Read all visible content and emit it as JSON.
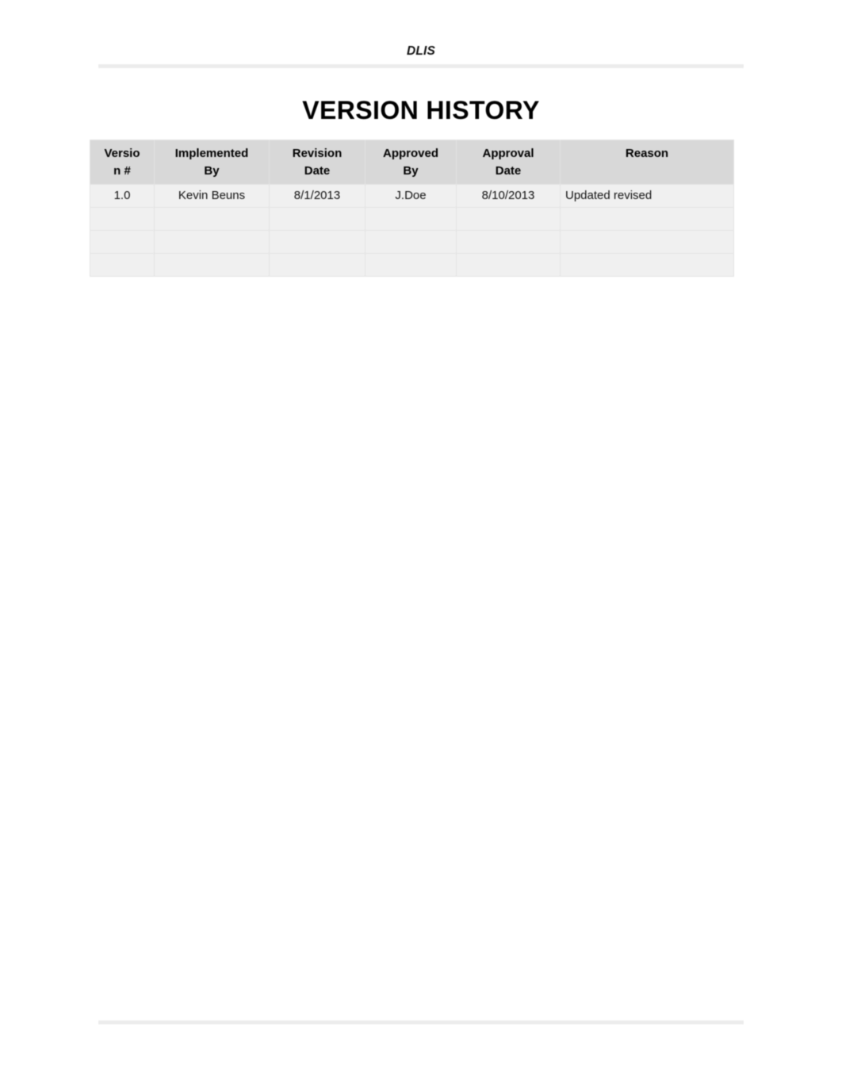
{
  "document": {
    "running_header": "DLIS",
    "page_title": "VERSION HISTORY",
    "footer_text": ""
  },
  "colors": {
    "header_row_background": "#d8d8d8",
    "body_row_background": "#f0f0f0",
    "rule": "#ececec",
    "border": "#e3e3e3",
    "text": "#000000"
  },
  "version_history_table": {
    "columns": [
      {
        "key": "version",
        "label": "Version #",
        "label_line1": "Versio",
        "label_line2": "n #",
        "align": "center"
      },
      {
        "key": "implemented_by",
        "label": "Implemented By",
        "label_line1": "Implemented",
        "label_line2": "By",
        "align": "center"
      },
      {
        "key": "revision_date",
        "label": "Revision Date",
        "label_line1": "Revision",
        "label_line2": "Date",
        "align": "center"
      },
      {
        "key": "approved_by",
        "label": "Approved By",
        "label_line1": "Approved",
        "label_line2": "By",
        "align": "center"
      },
      {
        "key": "approval_date",
        "label": "Approval Date",
        "label_line1": "Approval",
        "label_line2": "Date",
        "align": "center"
      },
      {
        "key": "reason",
        "label": "Reason",
        "label_line1": "Reason",
        "label_line2": "",
        "align": "center"
      }
    ],
    "rows": [
      {
        "version": "1.0",
        "implemented_by": "Kevin Beuns",
        "revision_date": "8/1/2013",
        "approved_by": "J.Doe",
        "approval_date": "8/10/2013",
        "reason": "Updated revised"
      },
      {
        "version": "",
        "implemented_by": "",
        "revision_date": "",
        "approved_by": "",
        "approval_date": "",
        "reason": ""
      },
      {
        "version": "",
        "implemented_by": "",
        "revision_date": "",
        "approved_by": "",
        "approval_date": "",
        "reason": ""
      },
      {
        "version": "",
        "implemented_by": "",
        "revision_date": "",
        "approved_by": "",
        "approval_date": "",
        "reason": ""
      }
    ]
  }
}
